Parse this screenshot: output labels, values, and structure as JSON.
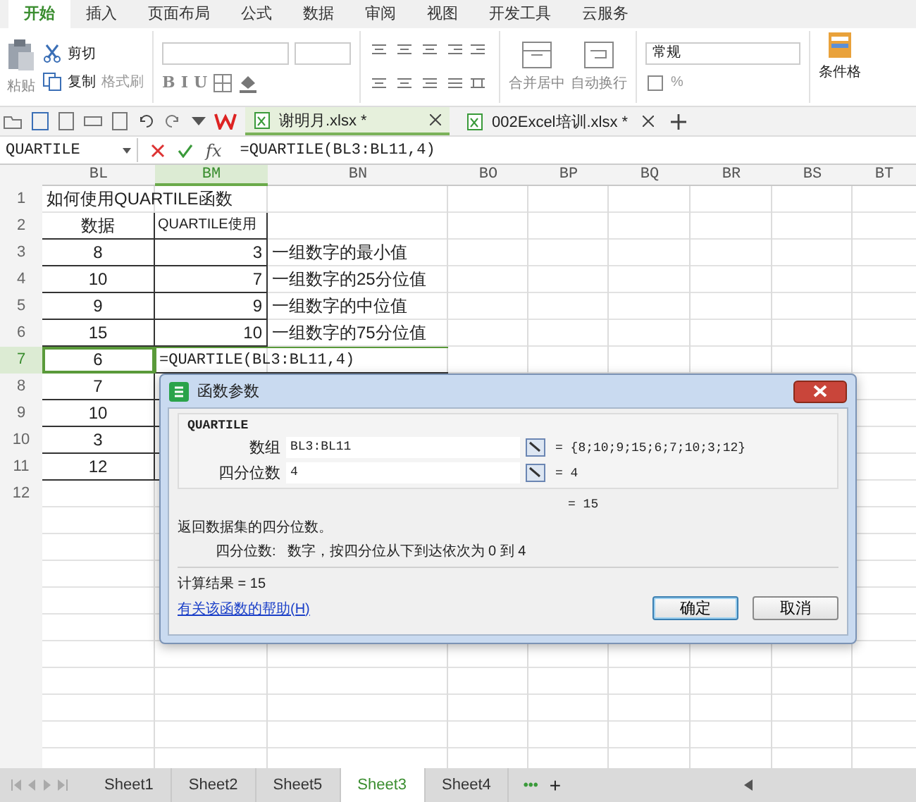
{
  "menu_tabs": [
    {
      "label": "开始",
      "selected": true
    },
    {
      "label": "插入",
      "selected": false
    },
    {
      "label": "页面布局",
      "selected": false
    },
    {
      "label": "公式",
      "selected": false
    },
    {
      "label": "数据",
      "selected": false
    },
    {
      "label": "审阅",
      "selected": false
    },
    {
      "label": "视图",
      "selected": false
    },
    {
      "label": "开发工具",
      "selected": false
    },
    {
      "label": "云服务",
      "selected": false
    }
  ],
  "ribbon": {
    "paste": "粘贴",
    "cut": "剪切",
    "copy": "复制",
    "format_painter": "格式刷",
    "font_styles": [
      "B",
      "I",
      "U"
    ],
    "merge": "合并居中",
    "wrap": "自动换行",
    "number_format": "常规",
    "percent": "%",
    "conditional_format": "条件格"
  },
  "doc_tabs": [
    {
      "label": "谢明月.xlsx *",
      "selected": true
    },
    {
      "label": "002Excel培训.xlsx *",
      "selected": false
    }
  ],
  "formula_bar": {
    "name_box": "QUARTILE",
    "fx": "fx",
    "formula": "=QUARTILE(BL3:BL11,4)"
  },
  "sheet": {
    "columns": [
      {
        "label": "BL",
        "selected": false
      },
      {
        "label": "BM",
        "selected": true
      },
      {
        "label": "BN",
        "selected": false
      },
      {
        "label": "BO",
        "selected": false
      },
      {
        "label": "BP",
        "selected": false
      },
      {
        "label": "BQ",
        "selected": false
      },
      {
        "label": "BR",
        "selected": false
      },
      {
        "label": "BS",
        "selected": false
      },
      {
        "label": "BT",
        "selected": false
      }
    ],
    "rows": [
      {
        "number": "1",
        "selected": false,
        "kind": "title",
        "cells": [
          "如何使用QUARTILE函数"
        ]
      },
      {
        "number": "2",
        "selected": false,
        "kind": "header",
        "cells": [
          "数据",
          "QUARTILE使用"
        ]
      },
      {
        "number": "3",
        "selected": false,
        "kind": "data",
        "cells": [
          "8",
          "3",
          "一组数字的最小值"
        ]
      },
      {
        "number": "4",
        "selected": false,
        "kind": "data",
        "cells": [
          "10",
          "7",
          "一组数字的25分位值"
        ]
      },
      {
        "number": "5",
        "selected": false,
        "kind": "data",
        "cells": [
          "9",
          "9",
          "一组数字的中位值"
        ]
      },
      {
        "number": "6",
        "selected": false,
        "kind": "data",
        "cells": [
          "15",
          "10",
          "一组数字的75分位值"
        ]
      },
      {
        "number": "7",
        "selected": true,
        "kind": "editing",
        "cells": [
          "6",
          "=QUARTILE(BL3:BL11,4)"
        ]
      },
      {
        "number": "8",
        "selected": false,
        "kind": "value",
        "cells": [
          "7"
        ]
      },
      {
        "number": "9",
        "selected": false,
        "kind": "value",
        "cells": [
          "10"
        ]
      },
      {
        "number": "10",
        "selected": false,
        "kind": "value",
        "cells": [
          "3"
        ]
      },
      {
        "number": "11",
        "selected": false,
        "kind": "value",
        "cells": [
          "12"
        ]
      },
      {
        "number": "12",
        "selected": false,
        "kind": "blank",
        "cells": []
      }
    ]
  },
  "dialog": {
    "title": "函数参数",
    "function_name": "QUARTILE",
    "arguments": [
      {
        "label": "数组",
        "value": "BL3:BL11",
        "result": "= {8;10;9;15;6;7;10;3;12}"
      },
      {
        "label": "四分位数",
        "value": "4",
        "result": "= 4"
      }
    ],
    "formula_result": "= 15",
    "description": "返回数据集的四分位数。",
    "argument_help_label": "四分位数:",
    "argument_help": "数字，按四分位从下到达依次为 0 到 4",
    "calc_result": "计算结果 = 15",
    "help_link": "有关该函数的帮助(H)",
    "buttons": [
      {
        "label": "确定",
        "kind": "primary"
      },
      {
        "label": "取消",
        "kind": "normal"
      }
    ]
  },
  "sheet_tabs": [
    {
      "label": "Sheet1",
      "selected": false
    },
    {
      "label": "Sheet2",
      "selected": false
    },
    {
      "label": "Sheet5",
      "selected": false
    },
    {
      "label": "Sheet3",
      "selected": true
    },
    {
      "label": "Sheet4",
      "selected": false
    }
  ],
  "sheet_tabs_more": "•••",
  "sheet_tabs_add": "+"
}
